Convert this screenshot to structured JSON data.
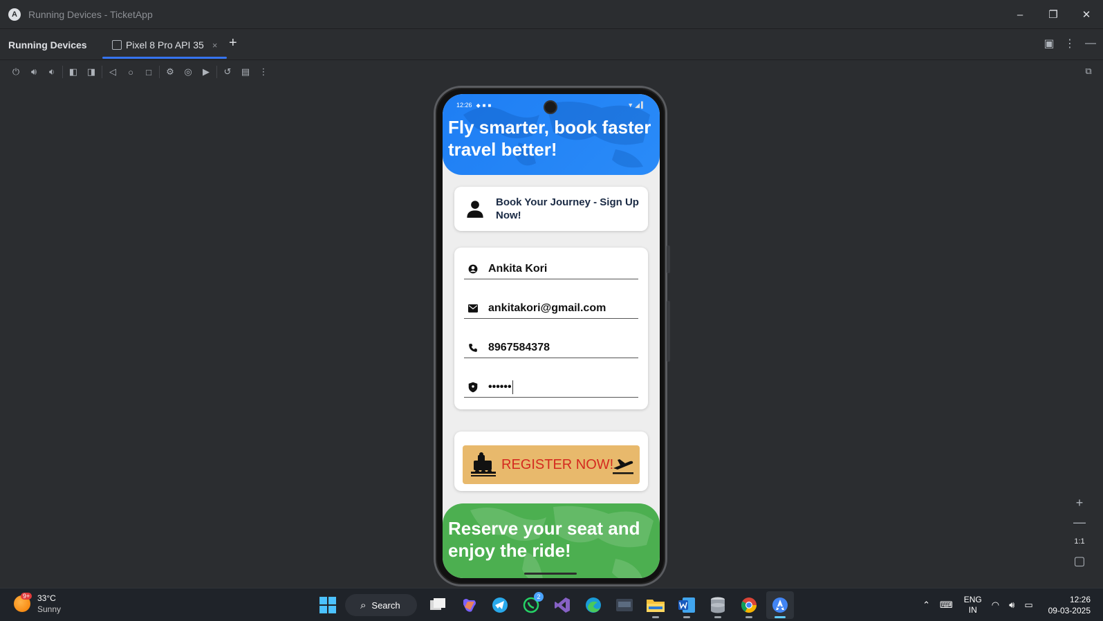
{
  "window": {
    "title": "Running Devices - TicketApp",
    "logo": "A"
  },
  "tabs": {
    "panel_title": "Running Devices",
    "device_tab_label": "Pixel 8 Pro API 35",
    "close_glyph": "×",
    "add_glyph": "+"
  },
  "zoom": {
    "in": "+",
    "out": "—",
    "fit": "1:1"
  },
  "phone": {
    "status_time": "12:26",
    "hero_title": "Fly smarter, book faster travel better!",
    "signup_text": "Book Your Journey - Sign Up Now!",
    "fields": {
      "name": "Ankita Kori",
      "email": "ankitakori@gmail.com",
      "phone": "8967584378",
      "password": "••••••"
    },
    "register_label": "REGISTER NOW!",
    "footer_title": "Reserve your seat and enjoy the ride!"
  },
  "taskbar": {
    "weather_temp": "33°C",
    "weather_cond": "Sunny",
    "weather_badge": "9+",
    "search_label": "Search",
    "whatsapp_badge": "2",
    "lang_top": "ENG",
    "lang_bottom": "IN",
    "time": "12:26",
    "date": "09-03-2025"
  },
  "colors": {
    "accent": "#3574f0",
    "hero_blue": "#1e7ef4",
    "footer_green": "#4caf50",
    "register_bg": "#e8b96c",
    "register_text": "#d42a1f"
  }
}
